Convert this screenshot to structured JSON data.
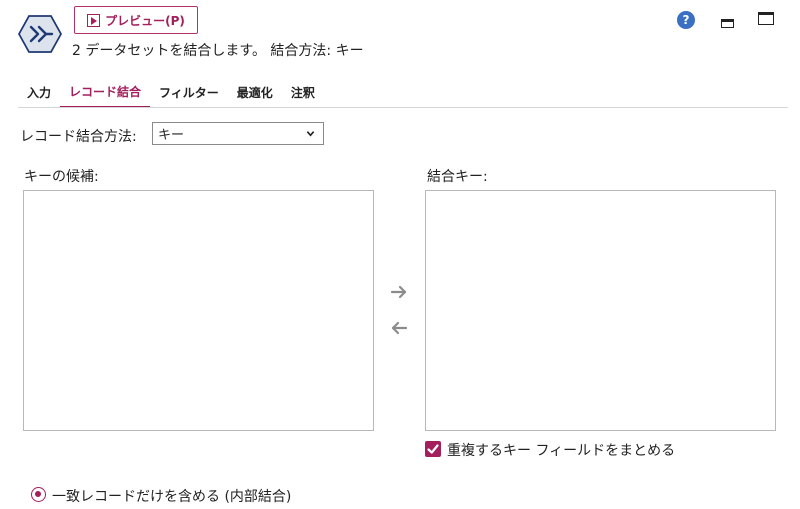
{
  "header": {
    "preview_label": "プレビュー(P)",
    "subtitle": "2 データセットを結合します。 結合方法: キー",
    "help_glyph": "?"
  },
  "icons": {
    "node": "merge-node-icon",
    "preview": "play-icon",
    "help": "help-icon",
    "minimize": "minimize-icon",
    "maximize": "maximize-icon",
    "dropdown": "chevron-down-icon",
    "move_right": "arrow-right-icon",
    "move_left": "arrow-left-icon",
    "checkbox": "checkbox-checked-icon",
    "radio": "radio-selected-icon"
  },
  "tabs": [
    {
      "label": "入力",
      "active": false
    },
    {
      "label": "レコード結合",
      "active": true
    },
    {
      "label": "フィルター",
      "active": false
    },
    {
      "label": "最適化",
      "active": false
    },
    {
      "label": "注釈",
      "active": false
    }
  ],
  "method": {
    "label": "レコード結合方法:",
    "value": "キー"
  },
  "candidates": {
    "label": "キーの候補:",
    "items": []
  },
  "merge_keys": {
    "label": "結合キー:",
    "items": []
  },
  "options": {
    "combine_duplicates_label": "重複するキー フィールドをまとめる",
    "combine_duplicates_checked": true,
    "inner_join_label": "一致レコードだけを含める (内部結合)",
    "inner_join_selected": true
  },
  "colors": {
    "accent": "#a3205c",
    "node_icon_fill": "#dde3ec",
    "node_icon_stroke": "#1f3a73",
    "help_blue": "#3a6fc4",
    "arrow_gray": "#8c8c8c"
  }
}
